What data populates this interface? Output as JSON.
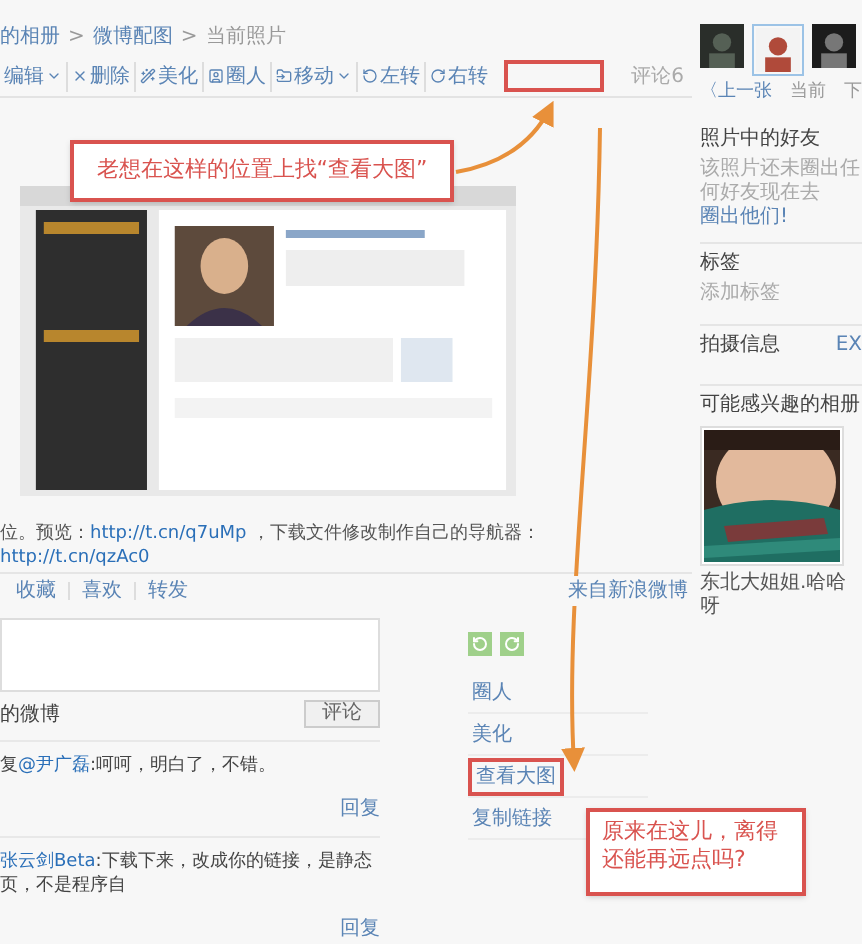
{
  "breadcrumb": {
    "items": [
      "的相册",
      "微博配图",
      "当前照片"
    ],
    "separator": ">"
  },
  "toolbar": {
    "items": [
      {
        "label": "编辑",
        "dropdown": true
      },
      {
        "label": "删除",
        "dropdown": false
      },
      {
        "label": "美化",
        "dropdown": false
      },
      {
        "label": "圈人",
        "dropdown": false
      },
      {
        "label": "移动",
        "dropdown": true
      },
      {
        "label": "左转",
        "dropdown": false
      },
      {
        "label": "右转",
        "dropdown": false
      }
    ],
    "comment_count": "评论6"
  },
  "callouts": [
    "老想在这样的位置上找“查看大图”",
    "原来在这儿，离得还能再远点吗?"
  ],
  "photo": {
    "kind": "picture"
  },
  "caption": {
    "text": "位。预览：",
    "link": "http://t.cn/q7uMp",
    "middle": " ，下载文件修改制作自己的导航器：",
    "link2": "http://t.cn/qzAc0"
  },
  "actions": [
    "收藏",
    "喜欢",
    "转发"
  ],
  "source": "来自新浪微博",
  "comment_form": {
    "share_label": "的微博",
    "submit": "评论"
  },
  "comments": [
    {
      "prefix": "复",
      "author": "@尹广磊",
      "text": ":呵呵，明白了，不错。",
      "reply": "回复"
    },
    {
      "author": "张云剑Beta",
      "text": ":下载下来，改成你的链接，是静态页，不是程序自",
      "reply": "回复"
    }
  ],
  "photo_menu": [
    {
      "label": "圈人",
      "highlighted": false
    },
    {
      "label": "美化",
      "highlighted": false
    },
    {
      "label": "查看大图",
      "highlighted": true
    },
    {
      "label": "复制链接",
      "highlighted": false
    }
  ],
  "sidebar": {
    "prev": "〈上一张",
    "current": "当前",
    "next": "下",
    "friends_title": "照片中的好友",
    "friends_empty": "该照片还未圈出任何好友",
    "friends_prompt": "现在去",
    "friends_link": "圈出他们!",
    "tags_title": "标签",
    "tags_add": "添加标签",
    "shot_title": "拍摄信息",
    "exif": "EX",
    "albums_title": "可能感兴趣的相册",
    "album_caption": "东北大姐姐.哈哈呀"
  }
}
